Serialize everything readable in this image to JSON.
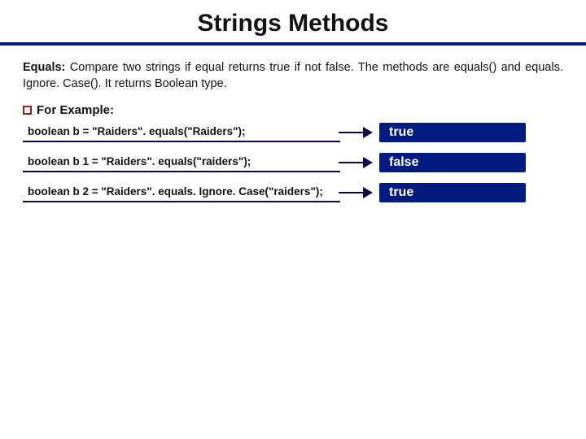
{
  "title": "Strings Methods",
  "body": {
    "lead": "Equals:",
    "text": " Compare two strings if equal returns true if not false. The methods are equals() and equals. Ignore. Case(). It returns Boolean type."
  },
  "example_heading": "For Example:",
  "rows": [
    {
      "code": "boolean b = \"Raiders\". equals(\"Raiders\");",
      "result": "true"
    },
    {
      "code": "boolean b 1 = \"Raiders\". equals(\"raiders\");",
      "result": "false"
    },
    {
      "code": "boolean b 2 = \"Raiders\". equals. Ignore. Case(\"raiders\");",
      "result": "true"
    }
  ]
}
